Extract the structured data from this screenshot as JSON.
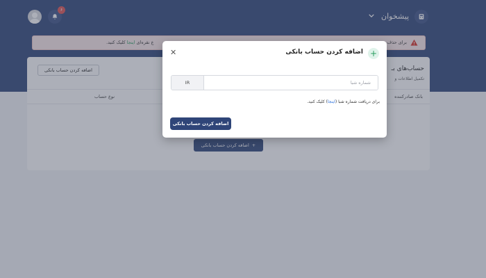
{
  "header": {
    "dashboard_title": "پیشخوان",
    "notification_count": "۶"
  },
  "alert": {
    "text_right": "برای حذف",
    "text_left_prefix": "ع نقره‌ای",
    "text_left_link": "اینجا",
    "text_left_suffix": "کلیک کنید."
  },
  "card": {
    "title": "حساب‌های بـ",
    "subtitle": "تکمیل اطلاعات و",
    "add_outline_label": "اضافه کردن حساب بانکی",
    "columns": {
      "bank": "بانک صادرکننده",
      "type": "نوع حساب"
    },
    "add_main_label": "اضافه کردن حساب بانکی"
  },
  "modal": {
    "title": "اضافه کردن حساب بانکی",
    "iban_prefix": "IR",
    "iban_placeholder": "شماره شبا",
    "hint_prefix": "برای دریافت شماره شبا",
    "hint_link": "اینجا",
    "hint_suffix": "کلیک کنید.",
    "submit_label": "اضافه کردن حساب بانکی"
  },
  "colors": {
    "primary": "#2f4578",
    "alert_bg": "#fbeaea",
    "alert_icon": "#d93025",
    "success": "#2a9d5f"
  }
}
